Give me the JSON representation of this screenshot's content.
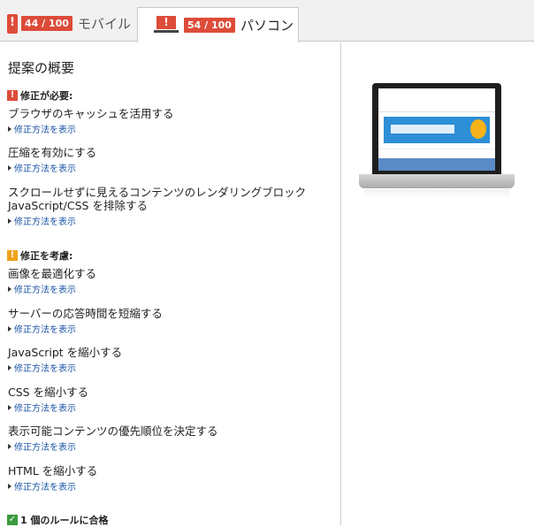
{
  "tabs": {
    "mobile": {
      "score": "44 / 100",
      "label": "モバイル"
    },
    "desktop": {
      "score": "54 / 100",
      "label": "パソコン"
    }
  },
  "summary_title": "提案の概要",
  "must_fix": {
    "heading": "修正が必要:",
    "rules": [
      {
        "title": "ブラウザのキャッシュを活用する",
        "link": "修正方法を表示"
      },
      {
        "title": "圧縮を有効にする",
        "link": "修正方法を表示"
      },
      {
        "title": "スクロールせずに見えるコンテンツのレンダリングブロック",
        "title2": "JavaScript/CSS を排除する",
        "link": "修正方法を表示"
      }
    ]
  },
  "consider_fix": {
    "heading": "修正を考慮:",
    "rules": [
      {
        "title": "画像を最適化する",
        "link": "修正方法を表示"
      },
      {
        "title": "サーバーの応答時間を短縮する",
        "link": "修正方法を表示"
      },
      {
        "title": "JavaScript を縮小する",
        "link": "修正方法を表示"
      },
      {
        "title": "CSS を縮小する",
        "link": "修正方法を表示"
      },
      {
        "title": "表示可能コンテンツの優先順位を決定する",
        "link": "修正方法を表示"
      },
      {
        "title": "HTML を縮小する",
        "link": "修正方法を表示"
      }
    ]
  },
  "passed": {
    "heading": "1 個のルールに合格"
  },
  "icons": {
    "error": "exclamation-icon",
    "warning": "exclamation-icon",
    "pass": "check-icon"
  },
  "colors": {
    "badge": "#dd4b39",
    "link": "#1a53a6",
    "warning": "#f0a21b",
    "pass": "#3c9a3c"
  }
}
